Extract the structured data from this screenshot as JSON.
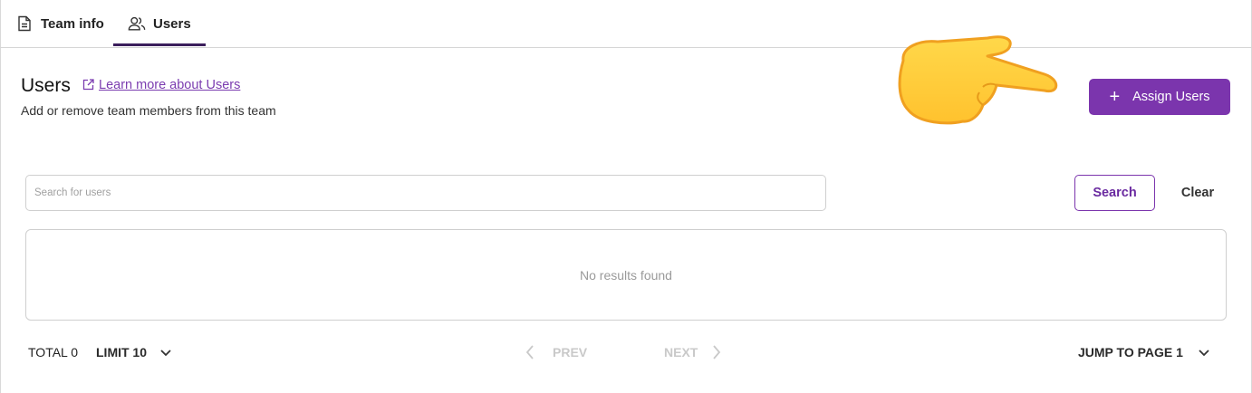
{
  "tabs": [
    {
      "label": "Team info",
      "icon": "document-icon",
      "active": false
    },
    {
      "label": "Users",
      "icon": "users-icon",
      "active": true
    }
  ],
  "header": {
    "title": "Users",
    "learn_more": "Learn more about Users",
    "subtitle": "Add or remove team members from this team"
  },
  "assign_button": {
    "label": "Assign Users",
    "icon": "plus-icon"
  },
  "search": {
    "placeholder": "Search for users",
    "value": "",
    "search_label": "Search",
    "clear_label": "Clear"
  },
  "results": {
    "empty_message": "No results found"
  },
  "footer": {
    "total_label": "TOTAL",
    "total_value": "0",
    "limit_label": "LIMIT 10",
    "prev_label": "PREV",
    "next_label": "NEXT",
    "jump_label": "JUMP TO PAGE 1"
  },
  "colors": {
    "accent": "#7b35ad",
    "tab_indicator": "#3b1e5c",
    "link": "#7b3cb0"
  },
  "overlay": {
    "icon": "pointing-hand-icon"
  }
}
